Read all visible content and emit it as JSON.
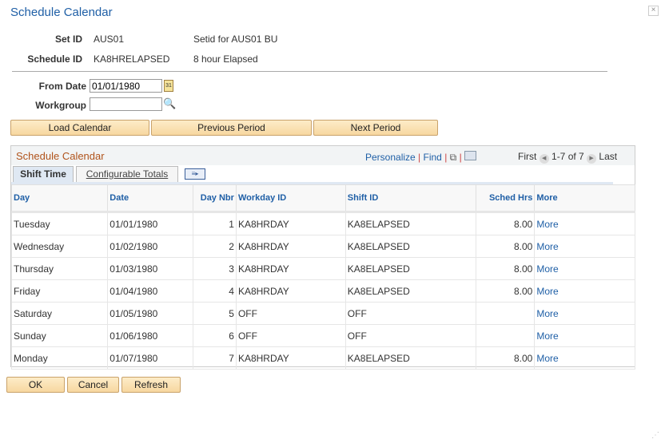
{
  "title": "Schedule Calendar",
  "header": {
    "setid_label": "Set ID",
    "setid": "AUS01",
    "setid_desc": "Setid for AUS01 BU",
    "schedule_label": "Schedule ID",
    "schedule": "KA8HRELAPSED",
    "schedule_desc": "8 hour Elapsed"
  },
  "form": {
    "from_date_label": "From Date",
    "from_date": "01/01/1980",
    "workgroup_label": "Workgroup",
    "workgroup": ""
  },
  "buttons": {
    "load": "Load Calendar",
    "prev": "Previous Period",
    "next": "Next Period",
    "ok": "OK",
    "cancel": "Cancel",
    "refresh": "Refresh"
  },
  "grid": {
    "title": "Schedule Calendar",
    "personalize": "Personalize",
    "find": "Find",
    "first": "First",
    "range": "1-7 of 7",
    "last": "Last",
    "tabs": [
      "Shift Time",
      "Configurable Totals"
    ],
    "columns": [
      "Day",
      "Date",
      "Day Nbr",
      "Workday ID",
      "Shift ID",
      "Sched Hrs",
      "More"
    ],
    "rows": [
      [
        "Tuesday",
        "01/01/1980",
        "1",
        "KA8HRDAY",
        "KA8ELAPSED",
        "8.00",
        "More"
      ],
      [
        "Wednesday",
        "01/02/1980",
        "2",
        "KA8HRDAY",
        "KA8ELAPSED",
        "8.00",
        "More"
      ],
      [
        "Thursday",
        "01/03/1980",
        "3",
        "KA8HRDAY",
        "KA8ELAPSED",
        "8.00",
        "More"
      ],
      [
        "Friday",
        "01/04/1980",
        "4",
        "KA8HRDAY",
        "KA8ELAPSED",
        "8.00",
        "More"
      ],
      [
        "Saturday",
        "01/05/1980",
        "5",
        "OFF",
        "OFF",
        "",
        "More"
      ],
      [
        "Sunday",
        "01/06/1980",
        "6",
        "OFF",
        "OFF",
        "",
        "More"
      ],
      [
        "Monday",
        "01/07/1980",
        "7",
        "KA8HRDAY",
        "KA8ELAPSED",
        "8.00",
        "More"
      ]
    ]
  }
}
